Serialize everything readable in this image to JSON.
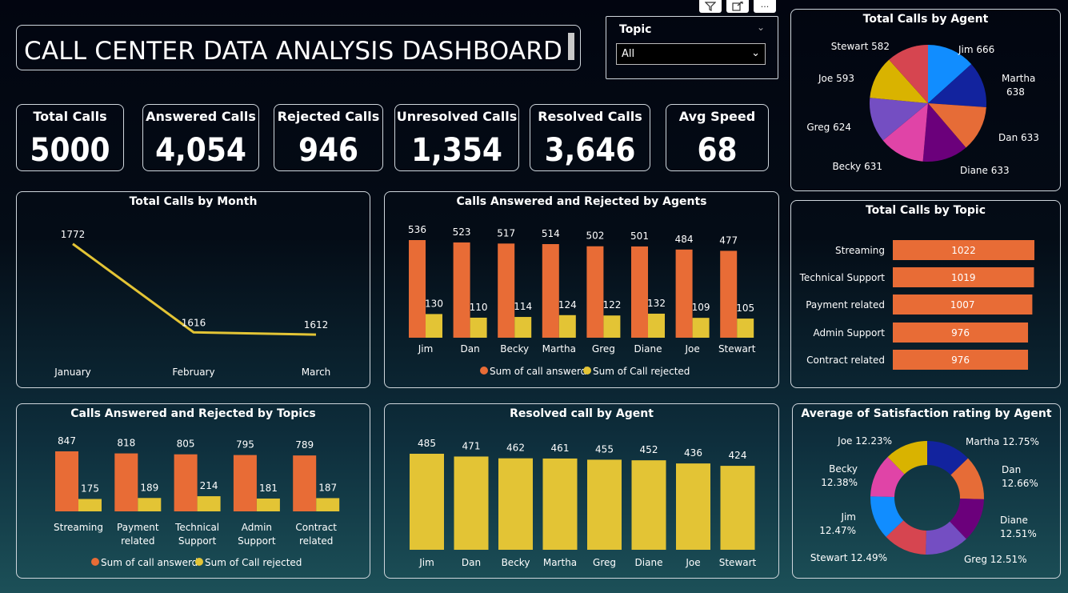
{
  "header": {
    "title": "CALL CENTER DATA ANALYSIS DASHBOARD"
  },
  "toolbar": {
    "filter_icon": "filter-icon",
    "focus_icon": "focus-mode-icon",
    "more_icon": "more-options-icon",
    "more_label": "···"
  },
  "slicer": {
    "label": "Topic",
    "value": "All"
  },
  "kpis": [
    {
      "label": "Total Calls",
      "value": "5000"
    },
    {
      "label": "Answered Calls",
      "value": "4,054"
    },
    {
      "label": "Rejected Calls",
      "value": "946"
    },
    {
      "label": "Unresolved Calls",
      "value": "1,354"
    },
    {
      "label": "Resolved Calls",
      "value": "3,646"
    },
    {
      "label": "Avg Speed",
      "value": "68"
    }
  ],
  "colors": {
    "orange": "#e86c36",
    "yellow": "#e3c435"
  },
  "chart_data": [
    {
      "id": "month",
      "type": "line",
      "title": "Total Calls by Month",
      "categories": [
        "January",
        "February",
        "March"
      ],
      "values": [
        1772,
        1616,
        1612
      ]
    },
    {
      "id": "agents",
      "type": "bar",
      "title": "Calls Answered and Rejected by Agents",
      "categories": [
        "Jim",
        "Dan",
        "Becky",
        "Martha",
        "Greg",
        "Diane",
        "Joe",
        "Stewart"
      ],
      "series": [
        {
          "name": "Sum of call answerd",
          "values": [
            536,
            523,
            517,
            514,
            502,
            501,
            484,
            477
          ]
        },
        {
          "name": "Sum of Call rejected",
          "values": [
            130,
            110,
            114,
            124,
            122,
            132,
            109,
            105
          ]
        }
      ]
    },
    {
      "id": "topics",
      "type": "bar",
      "title": "Calls Answered and Rejected by Topics",
      "categories": [
        "Streaming",
        "Payment related",
        "Technical Support",
        "Admin Support",
        "Contract related"
      ],
      "series": [
        {
          "name": "Sum of call answerd",
          "values": [
            847,
            818,
            805,
            795,
            789
          ]
        },
        {
          "name": "Sum of Call rejected",
          "values": [
            175,
            189,
            214,
            181,
            187
          ]
        }
      ]
    },
    {
      "id": "resolved",
      "type": "bar",
      "title": "Resolved call by Agent",
      "categories": [
        "Jim",
        "Dan",
        "Becky",
        "Martha",
        "Greg",
        "Diane",
        "Joe",
        "Stewart"
      ],
      "values": [
        485,
        471,
        462,
        461,
        455,
        452,
        436,
        424
      ]
    },
    {
      "id": "agentpie",
      "type": "pie",
      "title": "Total Calls by Agent",
      "labels": [
        "Jim",
        "Martha",
        "Dan",
        "Diane",
        "Becky",
        "Greg",
        "Joe",
        "Stewart"
      ],
      "values": [
        666,
        638,
        633,
        633,
        631,
        624,
        593,
        582
      ],
      "colors": [
        "#118dff",
        "#12239e",
        "#e66c37",
        "#6b007b",
        "#e044a7",
        "#744ec2",
        "#d9b300",
        "#d64550"
      ]
    },
    {
      "id": "topicbar",
      "type": "bar",
      "title": "Total Calls by Topic",
      "categories": [
        "Streaming",
        "Technical Support",
        "Payment related",
        "Admin Support",
        "Contract related"
      ],
      "values": [
        1022,
        1019,
        1007,
        976,
        976
      ]
    },
    {
      "id": "satisfaction",
      "type": "pie",
      "title": "Average of Satisfaction rating by Agent",
      "labels": [
        "Martha",
        "Dan",
        "Diane",
        "Greg",
        "Stewart",
        "Jim",
        "Becky",
        "Joe"
      ],
      "values": [
        12.75,
        12.66,
        12.51,
        12.51,
        12.49,
        12.47,
        12.38,
        12.23
      ],
      "value_labels": [
        "12.75%",
        "12.66%",
        "12.51%",
        "12.51%",
        "12.49%",
        "12.47%",
        "12.38%",
        "12.23%"
      ],
      "colors": [
        "#12239e",
        "#e66c37",
        "#6b007b",
        "#744ec2",
        "#d64550",
        "#118dff",
        "#e044a7",
        "#d9b300"
      ]
    }
  ]
}
